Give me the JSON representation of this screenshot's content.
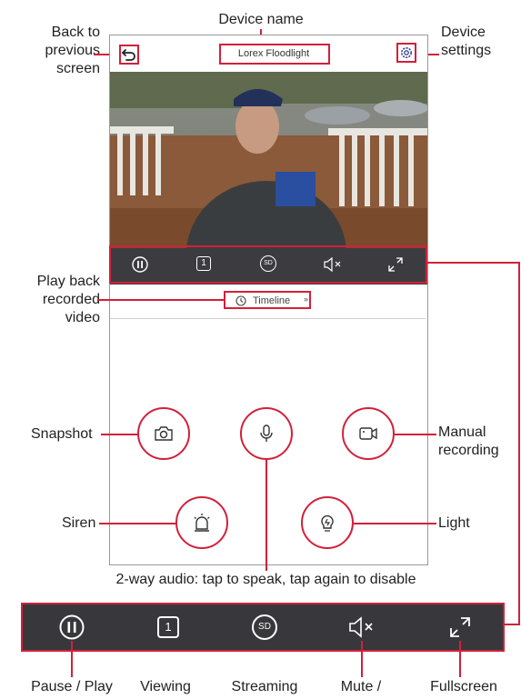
{
  "header": {
    "device_name": "Lorex Floodlight"
  },
  "timeline": {
    "label": "Timeline"
  },
  "callouts": {
    "back": "Back to previous screen",
    "device_name": "Device name",
    "device_settings": "Device settings",
    "playback": "Play back recorded video",
    "snapshot": "Snapshot",
    "manual_recording": "Manual recording",
    "siren": "Siren",
    "light": "Light",
    "two_way_audio": "2-way audio: tap to speak, tap again to disable",
    "pause_play": "Pause / Play",
    "viewing": "Viewing",
    "streaming": "Streaming",
    "mute": "Mute /",
    "fullscreen": "Fullscreen"
  },
  "controls": {
    "channel_number": "1",
    "quality": "SD"
  },
  "colors": {
    "accent": "#d2203a",
    "control_bar": "#3c3c40",
    "icon": "#ffffff"
  },
  "icons": [
    "back-arrow-icon",
    "gear-icon",
    "pause-icon",
    "channel-icon",
    "sd-icon",
    "mute-icon",
    "fullscreen-icon",
    "history-icon",
    "camera-icon",
    "microphone-icon",
    "video-record-icon",
    "siren-icon",
    "lightbulb-icon"
  ]
}
